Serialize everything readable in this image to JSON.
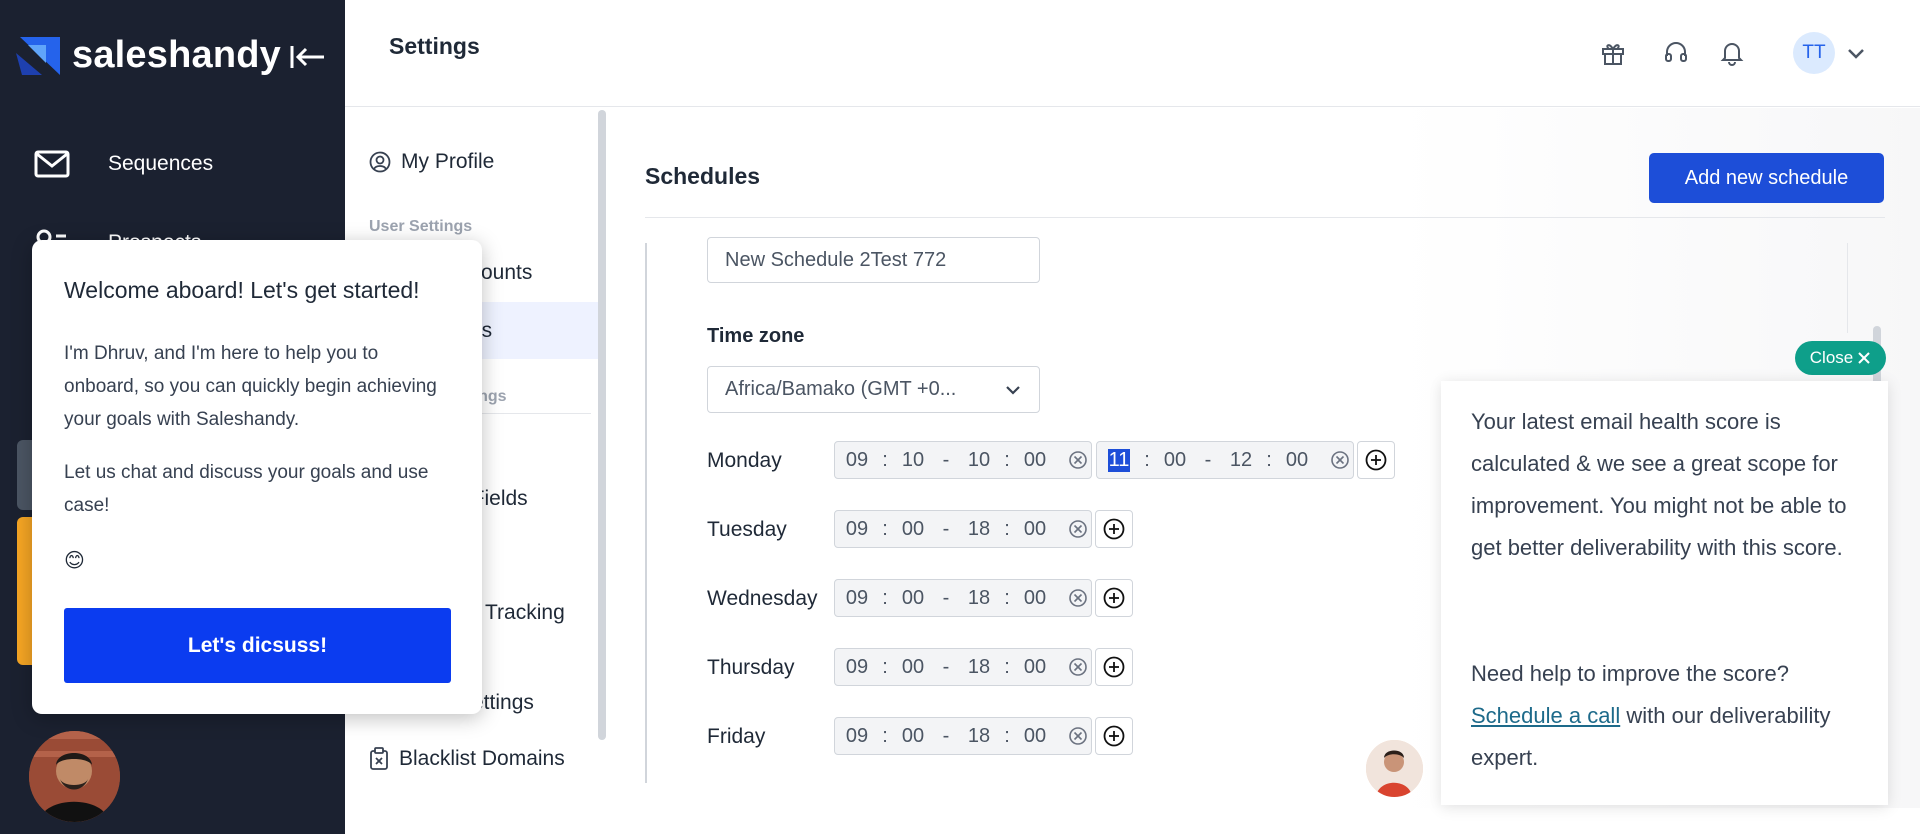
{
  "brand": {
    "name": "saleshandy"
  },
  "leftnav": {
    "items": [
      {
        "label": "Sequences"
      },
      {
        "label": "Prospects"
      }
    ]
  },
  "header": {
    "title": "Settings",
    "avatar_initials": "TT"
  },
  "settings_menu": {
    "my_profile": "My Profile",
    "user_settings_heading": "User Settings",
    "email_accounts_partial": "ccounts",
    "schedules_partial": "es",
    "other_settings_partial": "ttings",
    "custom_fields_partial": "t Fields",
    "tracking_partial": "Tracking",
    "settings_partial": "ettings",
    "blacklist_domains": "Blacklist Domains"
  },
  "schedules": {
    "title": "Schedules",
    "add_button": "Add new schedule",
    "name_value": "New Schedule 2Test 772",
    "timezone_label": "Time zone",
    "timezone_value": "Africa/Bamako (GMT +0...",
    "days": [
      {
        "label": "Monday",
        "slots": [
          {
            "sh": "09",
            "sm": "10",
            "eh": "10",
            "em": "00"
          },
          {
            "sh": "11",
            "sm": "00",
            "eh": "12",
            "em": "00",
            "highlight": true
          }
        ]
      },
      {
        "label": "Tuesday",
        "slots": [
          {
            "sh": "09",
            "sm": "00",
            "eh": "18",
            "em": "00"
          }
        ]
      },
      {
        "label": "Wednesday",
        "slots": [
          {
            "sh": "09",
            "sm": "00",
            "eh": "18",
            "em": "00"
          }
        ]
      },
      {
        "label": "Thursday",
        "slots": [
          {
            "sh": "09",
            "sm": "00",
            "eh": "18",
            "em": "00"
          }
        ]
      },
      {
        "label": "Friday",
        "slots": [
          {
            "sh": "09",
            "sm": "00",
            "eh": "18",
            "em": "00"
          }
        ]
      }
    ]
  },
  "welcome": {
    "title": "Welcome aboard! Let's get started!",
    "para1": "I'm Dhruv, and I'm here to help you to onboard, so you can quickly begin achieving your goals with Saleshandy.",
    "para2": "Let us chat and discuss your goals and use case!",
    "emoji": "😊",
    "button": "Let's dicsuss!"
  },
  "health": {
    "close_label": "Close",
    "para1": "Your latest email health score is calculated & we see a great scope for improvement. You might not be able to get better deliverability with this score.",
    "para2_prefix": "Need help to improve the score?",
    "link": "Schedule a call",
    "para2_suffix": "with our deliverability expert."
  },
  "colors": {
    "nav_bg": "#1b2130",
    "primary": "#1d4ed8",
    "welcome_button": "#0b3cf0",
    "close_pill": "#0e9f8a",
    "nav_accent": "#f5a524"
  },
  "icons": [
    "logo-icon",
    "collapse-icon",
    "mail-icon",
    "prospects-icon",
    "gift-icon",
    "headset-icon",
    "bell-icon",
    "chevron-down-icon",
    "user-circle-icon",
    "clipboard-x-icon",
    "clear-icon",
    "plus-circle-icon",
    "close-icon"
  ]
}
